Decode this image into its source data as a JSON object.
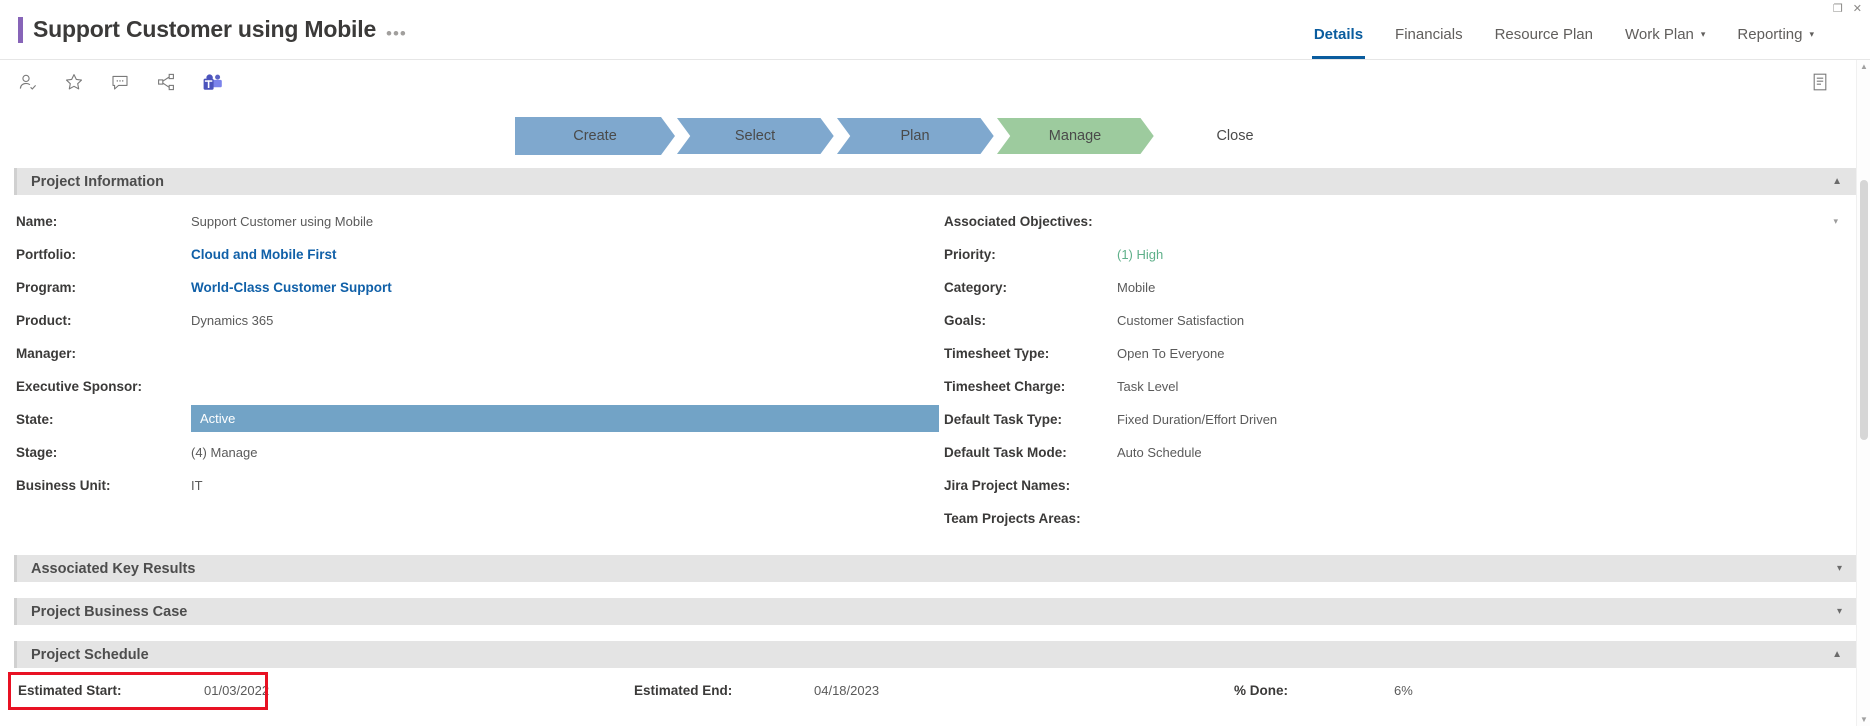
{
  "window": {
    "restore_glyph": "❐",
    "close_glyph": "✕"
  },
  "header": {
    "title": "Support Customer using Mobile",
    "ellipsis": "•••",
    "accent_color": "#8764b8",
    "tabs": [
      {
        "label": "Details",
        "active": true,
        "caret": ""
      },
      {
        "label": "Financials",
        "active": false,
        "caret": ""
      },
      {
        "label": "Resource Plan",
        "active": false,
        "caret": ""
      },
      {
        "label": "Work Plan",
        "active": false,
        "caret": "▾"
      },
      {
        "label": "Reporting",
        "active": false,
        "caret": "▾"
      }
    ],
    "active_tab_color": "#0a5c9e"
  },
  "toolbar": {
    "icons": [
      "add-person-icon",
      "star-icon",
      "comment-icon",
      "share-icon",
      "teams-icon"
    ],
    "right_icon": "notes-icon"
  },
  "pipeline": {
    "stages": [
      {
        "label": "Create",
        "state": "done"
      },
      {
        "label": "Select",
        "state": "done"
      },
      {
        "label": "Plan",
        "state": "done"
      },
      {
        "label": "Manage",
        "state": "current"
      },
      {
        "label": "Close",
        "state": "upcoming"
      }
    ],
    "done_color": "#7fa8ce",
    "current_color": "#9dcb9e",
    "upcoming_color": "#ffffff"
  },
  "sections": {
    "project_information": {
      "title": "Project Information",
      "expanded": true,
      "chevron": "▲",
      "left_fields": [
        {
          "label": "Name:",
          "value": "Support Customer using Mobile",
          "style": "text"
        },
        {
          "label": "Portfolio:",
          "value": "Cloud and Mobile First",
          "style": "link"
        },
        {
          "label": "Program:",
          "value": "World-Class Customer Support",
          "style": "link"
        },
        {
          "label": "Product:",
          "value": "Dynamics 365",
          "style": "text"
        },
        {
          "label": "Manager:",
          "value": "",
          "style": "text"
        },
        {
          "label": "Executive Sponsor:",
          "value": "",
          "style": "text"
        },
        {
          "label": "State:",
          "value": "Active",
          "style": "highlight"
        },
        {
          "label": "Stage:",
          "value": "(4) Manage",
          "style": "text"
        },
        {
          "label": "Business Unit:",
          "value": "IT",
          "style": "text"
        }
      ],
      "right_fields": [
        {
          "label": "Associated Objectives:",
          "value": "",
          "style": "text",
          "caret": "▾"
        },
        {
          "label": "Priority:",
          "value": "(1) High",
          "style": "green"
        },
        {
          "label": "Category:",
          "value": "Mobile",
          "style": "text"
        },
        {
          "label": "Goals:",
          "value": "Customer Satisfaction",
          "style": "text"
        },
        {
          "label": "Timesheet Type:",
          "value": "Open To Everyone",
          "style": "text"
        },
        {
          "label": "Timesheet Charge:",
          "value": "Task Level",
          "style": "text"
        },
        {
          "label": "Default Task Type:",
          "value": "Fixed Duration/Effort Driven",
          "style": "text"
        },
        {
          "label": "Default Task Mode:",
          "value": "Auto Schedule",
          "style": "text"
        },
        {
          "label": "Jira Project Names:",
          "value": "",
          "style": "text"
        },
        {
          "label": "Team Projects Areas:",
          "value": "",
          "style": "text"
        }
      ]
    },
    "associated_key_results": {
      "title": "Associated Key Results",
      "expanded": false,
      "chevron": "▾"
    },
    "project_business_case": {
      "title": "Project Business Case",
      "expanded": false,
      "chevron": "▾"
    },
    "project_schedule": {
      "title": "Project Schedule",
      "expanded": true,
      "chevron": "▲",
      "fields": {
        "estimated_start_label": "Estimated Start:",
        "estimated_start_value": "01/03/2022",
        "estimated_end_label": "Estimated End:",
        "estimated_end_value": "04/18/2023",
        "percent_done_label": "% Done:",
        "percent_done_value": "6%"
      },
      "highlight_color": "#e81123",
      "highlighted_field": "estimated-start"
    }
  },
  "scrollbar": {
    "up_arrow": "▲",
    "down_arrow": "▼"
  }
}
